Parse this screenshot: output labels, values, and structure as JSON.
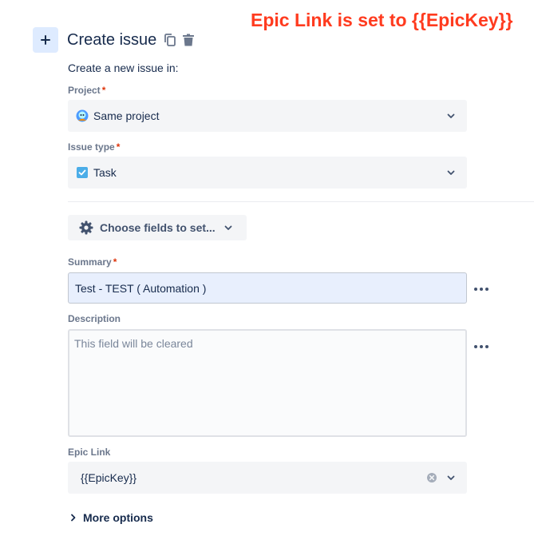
{
  "annotation": "Epic Link is set to {{EpicKey}}",
  "header": {
    "title": "Create issue",
    "plus_icon": "plus-icon",
    "copy_icon": "copy-icon",
    "delete_icon": "trash-icon"
  },
  "intro_text": "Create a new issue in:",
  "required_marker": "*",
  "project": {
    "label": "Project",
    "value": "Same project",
    "icon": "project-avatar-icon"
  },
  "issue_type": {
    "label": "Issue type",
    "value": "Task",
    "icon": "task-checkbox-icon"
  },
  "choose_fields": {
    "label": "Choose fields to set...",
    "icon": "gear-icon"
  },
  "summary": {
    "label": "Summary",
    "value": "Test - TEST ( Automation )"
  },
  "description": {
    "label": "Description",
    "placeholder": "This field will be cleared",
    "value": ""
  },
  "epic_link": {
    "label": "Epic Link",
    "value": "{{EpicKey}}"
  },
  "more_options": "More options",
  "colors": {
    "accent": "#0052cc",
    "annotation": "#ff3b1f",
    "required": "#de350b",
    "field_bg": "#f4f5f7",
    "summary_bg": "#e8effd",
    "task_blue": "#4bade8"
  }
}
